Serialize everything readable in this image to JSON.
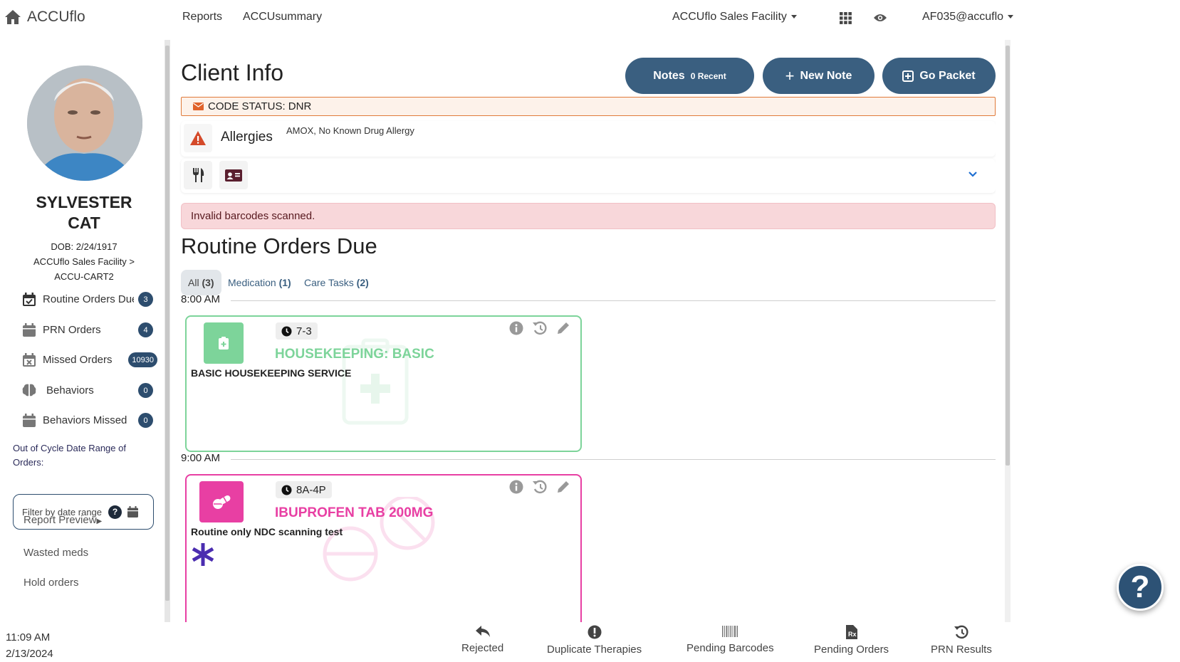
{
  "nav": {
    "brand": "ACCUflo",
    "links": [
      "Reports",
      "ACCUsummary"
    ],
    "facility": "ACCUflo Sales Facility",
    "user": "AF035@accuflo"
  },
  "patient": {
    "first_name": "SYLVESTER",
    "last_name": "CAT",
    "dob": "DOB: 2/24/1917",
    "location_line1": "ACCUflo Sales Facility >",
    "location_line2": "ACCU-CART2"
  },
  "sidebar": {
    "items": [
      {
        "label": "Routine Orders Due",
        "count": "3",
        "icon": "calendar-check-icon"
      },
      {
        "label": "PRN Orders",
        "count": "4",
        "icon": "calendar-icon"
      },
      {
        "label": "Missed Orders",
        "count": "10930",
        "icon": "calendar-x-icon"
      },
      {
        "label": "Behaviors",
        "count": "0",
        "icon": "brain-icon"
      },
      {
        "label": "Behaviors Missed",
        "count": "0",
        "icon": "calendar-icon"
      }
    ],
    "ooc_label": "Out of Cycle Date Range of Orders:",
    "date_filter_placeholder": "Filter by date range",
    "help_symbol": "?",
    "links": [
      "Report Preview",
      "Wasted meds",
      "Hold orders"
    ]
  },
  "main": {
    "title": "Client Info",
    "buttons": {
      "notes": "Notes",
      "notes_recent": "0 Recent",
      "new_note": "New Note",
      "go_packet": "Go Packet"
    },
    "code_status": "CODE STATUS: DNR",
    "allergies_label": "Allergies",
    "allergies_value": "AMOX, No Known Drug Allergy",
    "alert": "Invalid barcodes scanned.",
    "section_title": "Routine Orders Due",
    "tabs": [
      {
        "label": "All",
        "count": "(3)"
      },
      {
        "label": "Medication",
        "count": "(1)"
      },
      {
        "label": "Care Tasks",
        "count": "(2)"
      }
    ],
    "groups": [
      {
        "time": "8:00 AM",
        "order": {
          "shift": "7-3",
          "title": "HOUSEKEEPING: BASIC",
          "desc": "BASIC HOUSEKEEPING SERVICE",
          "color": "#7dd49a"
        }
      },
      {
        "time": "9:00 AM",
        "order": {
          "shift": "8A-4P",
          "title": "IBUPROFEN TAB 200MG",
          "desc": "Routine only NDC scanning test",
          "color": "#e83fa3"
        }
      }
    ]
  },
  "footer": {
    "time": "11:09 AM",
    "date": "2/13/2024",
    "buttons": [
      "Rejected",
      "Duplicate Therapies",
      "Pending Barcodes",
      "Pending Orders",
      "PRN Results"
    ]
  },
  "help_fab": "?"
}
